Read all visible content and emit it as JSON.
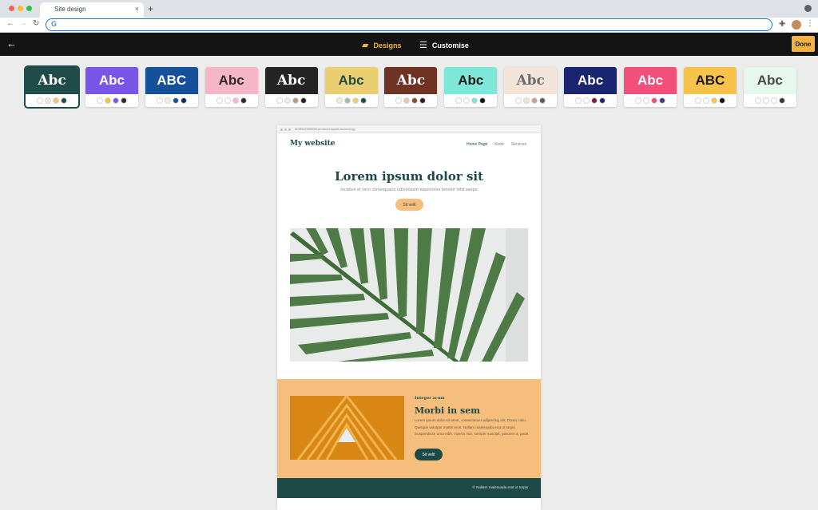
{
  "browser": {
    "tab_title": "Site design",
    "tab_close": "×",
    "new_tab": "+",
    "url": "",
    "nav_back": "←",
    "nav_forward": "→",
    "nav_reload": "↻",
    "google_icon": "G",
    "extensions_icon": "puzzle-icon",
    "menu_icon": "⋮"
  },
  "appbar": {
    "back_icon": "←",
    "designs_label": "Designs",
    "customise_label": "Customise",
    "done_label": "Done",
    "accent": "#f6b33c"
  },
  "themes": [
    {
      "sample": "Abc",
      "bg": "#1f4c49",
      "fg": "#ffffff",
      "serif": true,
      "selected": true,
      "dots": [
        "#ffffff",
        "#f2e6dc",
        "#f6be7c",
        "#1f4c49"
      ]
    },
    {
      "sample": "Abc",
      "bg": "#7a56e8",
      "fg": "#ffffff",
      "serif": false,
      "selected": false,
      "dots": [
        "#ffffff",
        "#f3c33c",
        "#7a56e8",
        "#2b2b2b"
      ]
    },
    {
      "sample": "ABC",
      "bg": "#15519b",
      "fg": "#ffffff",
      "serif": false,
      "selected": false,
      "dots": [
        "#ffffff",
        "#f0ede6",
        "#15519b",
        "#0e2d52"
      ]
    },
    {
      "sample": "Abc",
      "bg": "#f6b6c8",
      "fg": "#2b2b2b",
      "serif": false,
      "selected": false,
      "dots": [
        "#ffffff",
        "#ffffff",
        "#f6b6c8",
        "#2b2b2b"
      ]
    },
    {
      "sample": "Abc",
      "bg": "#242424",
      "fg": "#ffffff",
      "serif": true,
      "selected": false,
      "dots": [
        "#ffffff",
        "#f0ede6",
        "#b99a7a",
        "#242424"
      ]
    },
    {
      "sample": "Abc",
      "bg": "#e9cf6f",
      "fg": "#1f4c49",
      "serif": false,
      "selected": false,
      "dots": [
        "#f5ecd6",
        "#a9b5ad",
        "#e9cf6f",
        "#1f4c49"
      ]
    },
    {
      "sample": "Abc",
      "bg": "#6e3323",
      "fg": "#ffffff",
      "serif": true,
      "selected": false,
      "dots": [
        "#ffffff",
        "#e8c9a9",
        "#8a4a33",
        "#3a1a12"
      ]
    },
    {
      "sample": "Abc",
      "bg": "#7ee8d8",
      "fg": "#1a1a1a",
      "serif": false,
      "selected": false,
      "dots": [
        "#ffffff",
        "#ffffff",
        "#7ee8d8",
        "#111111"
      ]
    },
    {
      "sample": "Abc",
      "bg": "#f3e4da",
      "fg": "#6b6b6b",
      "serif": true,
      "selected": false,
      "dots": [
        "#ffffff",
        "#f0e1d5",
        "#c7a08a",
        "#5c5c5c"
      ]
    },
    {
      "sample": "Abc",
      "bg": "#1b2470",
      "fg": "#ffffff",
      "serif": false,
      "selected": false,
      "dots": [
        "#ffffff",
        "#ffffff",
        "#8a1a3b",
        "#1b2470"
      ]
    },
    {
      "sample": "Abc",
      "bg": "#f24f7a",
      "fg": "#ffffff",
      "serif": false,
      "selected": false,
      "dots": [
        "#ffffff",
        "#ffffff",
        "#f24f7a",
        "#4a3a7a"
      ]
    },
    {
      "sample": "ABC",
      "bg": "#f8c34a",
      "fg": "#1a1a1a",
      "serif": false,
      "selected": false,
      "dots": [
        "#ffffff",
        "#ffffff",
        "#f8c34a",
        "#111111"
      ]
    },
    {
      "sample": "Abc",
      "bg": "#e6f7ee",
      "fg": "#4a4a4a",
      "serif": false,
      "selected": false,
      "dots": [
        "#ffffff",
        "#ffffff",
        "#ffffff",
        "#3a3a3a"
      ]
    }
  ],
  "preview": {
    "url": "6b9f0d2f9f0f0f8.product.bayadl-technology",
    "logo": "My website",
    "nav": [
      "Home Page",
      "Store",
      "Services"
    ],
    "hero_title": "Lorem ipsum dolor sit",
    "hero_subtitle": "Incidunt et vero consequatur laboriosam asperiores tenetur nihil saepe",
    "hero_button": "Sit velit",
    "section_eyebrow": "Integer acum",
    "section_title": "Morbi in sem",
    "section_body": "Lorem ipsum dolor sit amet, consectetuer adipiscing elit. Donec odio. Quisque volutpat mattis eros. Nullam malesuada erat ut turpis. Suspendisse urna nibh, viverra non, semper suscipit, posuere a, pede.",
    "section_button": "Sit velit",
    "footer_text": "© Nullam malesuada erat ut turpis",
    "colors": {
      "primary": "#1d4a47",
      "accent": "#f6be7c"
    }
  }
}
